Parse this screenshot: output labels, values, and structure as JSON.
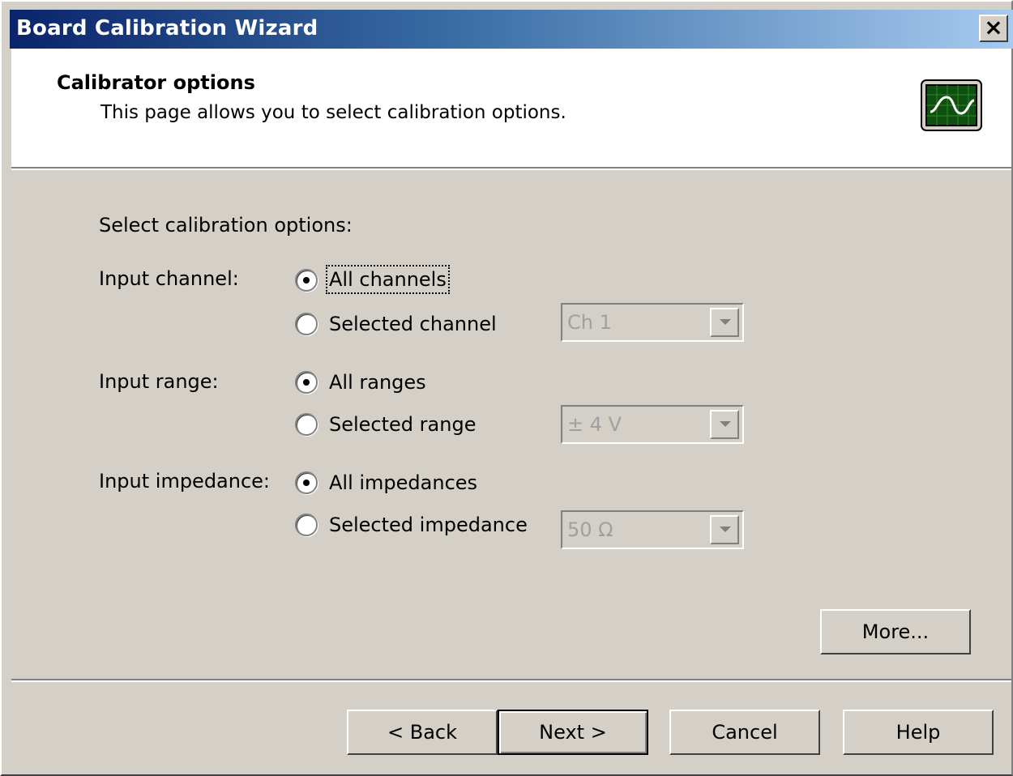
{
  "window": {
    "title": "Board Calibration Wizard",
    "close_label": "×"
  },
  "header": {
    "title": "Calibrator options",
    "subtitle": "This page allows you to select calibration options.",
    "icon": "oscilloscope-icon"
  },
  "form": {
    "intro": "Select calibration options:",
    "channel": {
      "label": "Input channel:",
      "option_all": "All channels",
      "option_selected": "Selected channel",
      "selected_value": "Ch 1",
      "checked": "all"
    },
    "range": {
      "label": "Input range:",
      "option_all": "All ranges",
      "option_selected": "Selected range",
      "selected_value": "± 4 V",
      "checked": "all"
    },
    "impedance": {
      "label": "Input impedance:",
      "option_all": "All impedances",
      "option_selected": "Selected impedance",
      "selected_value": "50 Ω",
      "checked": "all"
    },
    "more_label": "More..."
  },
  "footer": {
    "back_label": "< Back",
    "next_label": "Next >",
    "cancel_label": "Cancel",
    "help_label": "Help"
  },
  "colors": {
    "titlebar_start": "#0a246a",
    "titlebar_end": "#a6caf0",
    "dialog_face": "#d4d0c8",
    "icon_screen": "#1e6b1e",
    "icon_trace": "#ffffff"
  }
}
